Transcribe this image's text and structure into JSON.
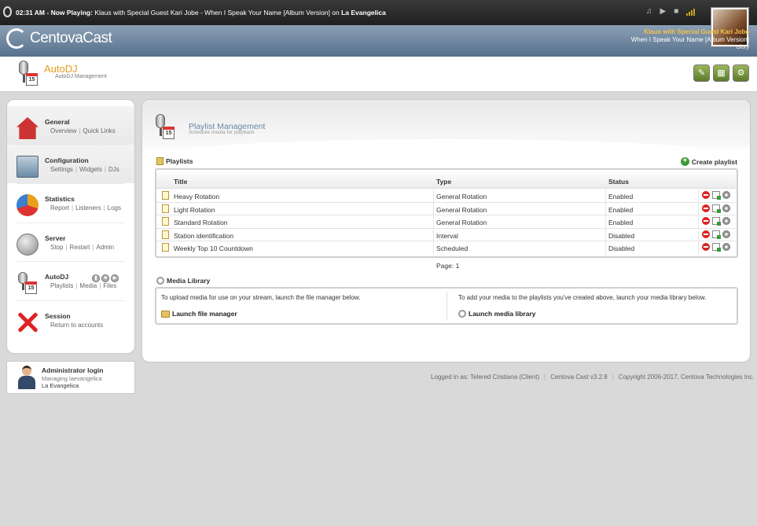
{
  "topbar": {
    "time": "02:31 AM",
    "now_playing_label": "Now Playing:",
    "track": "Klaus with Special Guest Kari Jobe - When I Speak Your Name [Album Version]",
    "on_label": "on",
    "station": "La Evangelica"
  },
  "player": {
    "icons": [
      "music-note-icon",
      "play-icon",
      "stop-icon",
      "volume-icon"
    ]
  },
  "app": {
    "name": "CentovaCast"
  },
  "now_info": {
    "artist": "Klaus with Special Guest Kari Jobe",
    "title": "When I Speak Your Name [Album Version]",
    "album": "Glory"
  },
  "page": {
    "title": "AutoDJ",
    "subtitle": "AutoDJ Management"
  },
  "sidebar": {
    "items": [
      {
        "name": "General",
        "links": [
          "Overview",
          "Quick Links"
        ],
        "icon": "home-icon"
      },
      {
        "name": "Configuration",
        "links": [
          "Settings",
          "Widgets",
          "DJs"
        ],
        "icon": "settings-panel-icon"
      },
      {
        "name": "Statistics",
        "links": [
          "Report",
          "Listeners",
          "Logs"
        ],
        "icon": "pie-chart-icon"
      },
      {
        "name": "Server",
        "links": [
          "Stop",
          "Restart",
          "Admin"
        ],
        "icon": "server-icon"
      },
      {
        "name": "AutoDJ",
        "links": [
          "Playlists",
          "Media",
          "Files"
        ],
        "icon": "autodj-icon"
      },
      {
        "name": "Session",
        "links": [
          "Return to accounts"
        ],
        "icon": "close-icon"
      }
    ]
  },
  "admin": {
    "title": "Administrator login",
    "managing": "Managing laevangelica",
    "station": "La Evangelica"
  },
  "main": {
    "title": "Playlist Management",
    "subtitle": "Schedule media for playback",
    "playlists_label": "Playlists",
    "create_label": "Create playlist",
    "columns": [
      "Title",
      "Type",
      "Status"
    ],
    "rows": [
      {
        "title": "Heavy Rotation",
        "type": "General Rotation",
        "status": "Enabled"
      },
      {
        "title": "Light Rotation",
        "type": "General Rotation",
        "status": "Enabled"
      },
      {
        "title": "Standard Rotation",
        "type": "General Rotation",
        "status": "Enabled"
      },
      {
        "title": "Station identification",
        "type": "Interval",
        "status": "Disabled"
      },
      {
        "title": "Weekly Top 10 Countdown",
        "type": "Scheduled",
        "status": "Disabled"
      }
    ],
    "page_label": "Page: 1",
    "media_library": {
      "label": "Media Library",
      "left_text": "To upload media for use on your stream, launch the file manager below.",
      "left_link": "Launch file manager",
      "right_text": "To add your media to the playlists you've created above, launch your media library below.",
      "right_link": "Launch media library"
    }
  },
  "footer": {
    "logged_in": "Logged in as: Telered Cristiana (Client)",
    "version": "Centova Cast v3.2.8",
    "copyright": "Copyright 2006-2017, Centova Technologies Inc."
  }
}
